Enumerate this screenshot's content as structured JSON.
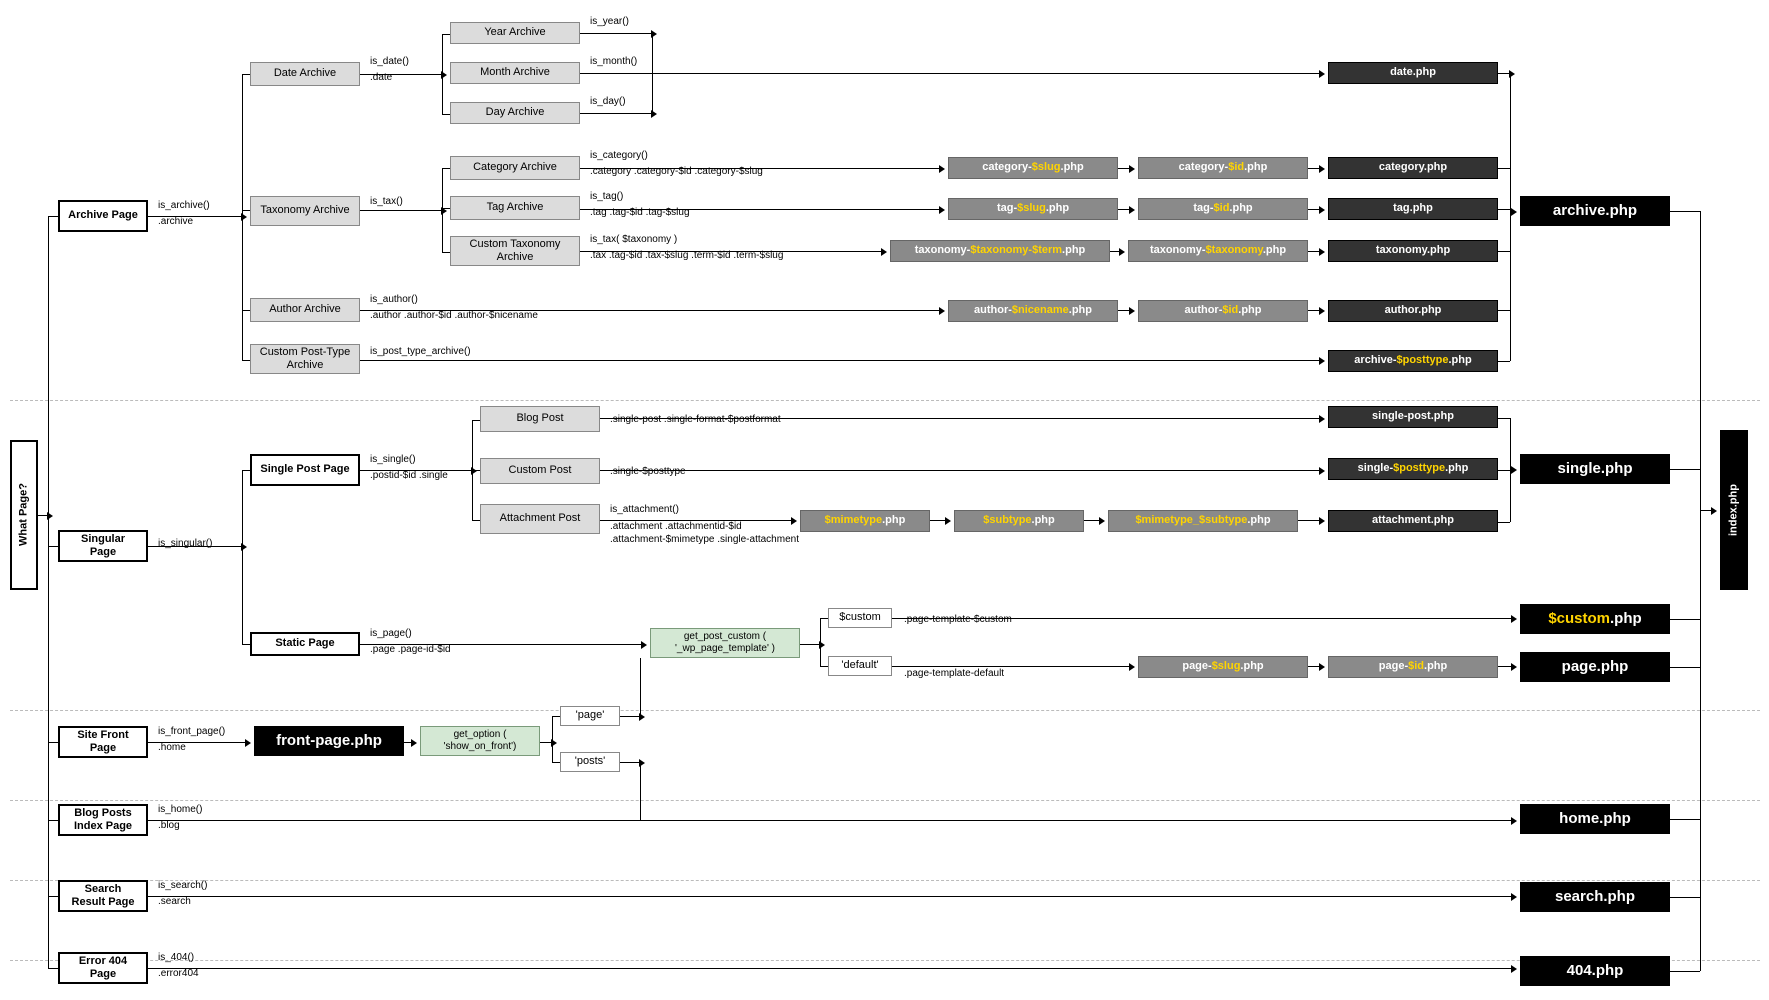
{
  "vertical": {
    "whatPage": "What Page?",
    "index": "index.php"
  },
  "col1": {
    "archive": "Archive Page",
    "singular": "Singular Page",
    "front": "Site Front Page",
    "blog": "Blog Posts Index Page",
    "search": "Search Result Page",
    "error": "Error 404 Page"
  },
  "lbl1": {
    "archive_fn": "is_archive()",
    "archive_cls": ".archive",
    "singular_fn": "is_singular()",
    "front_fn": "is_front_page()",
    "front_cls": ".home",
    "blog_fn": "is_home()",
    "blog_cls": ".blog",
    "search_fn": "is_search()",
    "search_cls": ".search",
    "error_fn": "is_404()",
    "error_cls": ".error404"
  },
  "col2": {
    "date": "Date Archive",
    "tax": "Taxonomy Archive",
    "author": "Author Archive",
    "cpt": "Custom Post-Type Archive",
    "single": "Single Post Page",
    "static": "Static Page"
  },
  "lbl2": {
    "date_fn": "is_date()",
    "date_cls": ".date",
    "tax_fn": "is_tax()",
    "author_fn": "is_author()",
    "author_cls": ".author .author-$id .author-$nicename",
    "cpt_fn": "is_post_type_archive()",
    "single_fn": "is_single()",
    "single_cls": ".postid-$id .single",
    "static_fn": "is_page()",
    "static_cls": ".page .page-id-$id"
  },
  "col3": {
    "year": "Year Archive",
    "month": "Month Archive",
    "day": "Day Archive",
    "cat": "Category Archive",
    "tag": "Tag Archive",
    "ctax": "Custom Taxonomy Archive",
    "blog": "Blog Post",
    "custom": "Custom Post",
    "att": "Attachment Post"
  },
  "lbl3": {
    "year_fn": "is_year()",
    "month_fn": "is_month()",
    "day_fn": "is_day()",
    "cat_fn": "is_category()",
    "cat_cls": ".category .category-$id .category-$slug",
    "tag_fn": "is_tag()",
    "tag_cls": ".tag .tag-$id .tag-$slug",
    "ctax_fn": "is_tax( $taxonomy )",
    "ctax_cls": ".tax .tag-$id .tax-$slug .term-$id .term-$slug",
    "blog_cls": ".single-post .single-format-$postformat",
    "custom_cls": ".single-$posttype",
    "att_fn": "is_attachment()",
    "att_cls": ".attachment .attachmentid-$id .attachment-$mimetype .single-attachment"
  },
  "green": {
    "gpc": "get_post_custom ( '_wp_page_template' )",
    "go": "get_option ( 'show_on_front')"
  },
  "wsmall": {
    "custom": "$custom",
    "default": "'default'",
    "page": "'page'",
    "posts": "'posts'"
  },
  "wsmall_lbl": {
    "custom": ".page-template-$custom",
    "default": ".page-template-default"
  },
  "grayBoxes": {
    "catslug": {
      "pre": "category-",
      "var": "$slug",
      "suf": ".php"
    },
    "catid": {
      "pre": "category-",
      "var": "$id",
      "suf": ".php"
    },
    "tagslug": {
      "pre": "tag-",
      "var": "$slug",
      "suf": ".php"
    },
    "tagid": {
      "pre": "tag-",
      "var": "$id",
      "suf": ".php"
    },
    "taxterm": {
      "pre": "taxonomy-",
      "var": "$taxonomy-$term",
      "suf": ".php"
    },
    "taxonly": {
      "pre": "taxonomy-",
      "var": "$taxonomy",
      "suf": ".php"
    },
    "authnice": {
      "pre": "author-",
      "var": "$nicename",
      "suf": ".php"
    },
    "authid": {
      "pre": "author-",
      "var": "$id",
      "suf": ".php"
    },
    "mime": {
      "pre": "",
      "var": "$mimetype",
      "suf": ".php"
    },
    "sub": {
      "pre": "",
      "var": "$subtype",
      "suf": ".php"
    },
    "mimesub": {
      "pre": "",
      "var": "$mimetype_$subtype",
      "suf": ".php"
    },
    "pageslug": {
      "pre": "page-",
      "var": "$slug",
      "suf": ".php"
    },
    "pageid": {
      "pre": "page-",
      "var": "$id",
      "suf": ".php"
    }
  },
  "darkBoxes": {
    "date": "date.php",
    "cat": "category.php",
    "tag": "tag.php",
    "tax": "taxonomy.php",
    "author": "author.php",
    "archpt": {
      "pre": "archive-",
      "var": "$posttype",
      "suf": ".php"
    },
    "sp": "single-post.php",
    "spt": {
      "pre": "single-",
      "var": "$posttype",
      "suf": ".php"
    },
    "att": "attachment.php"
  },
  "blackBoxes": {
    "archive": "archive.php",
    "single": "single.php",
    "custom": {
      "var": "$custom",
      "suf": ".php"
    },
    "page": "page.php",
    "home": "home.php",
    "search": "search.php",
    "err": "404.php",
    "front": "front-page.php"
  }
}
